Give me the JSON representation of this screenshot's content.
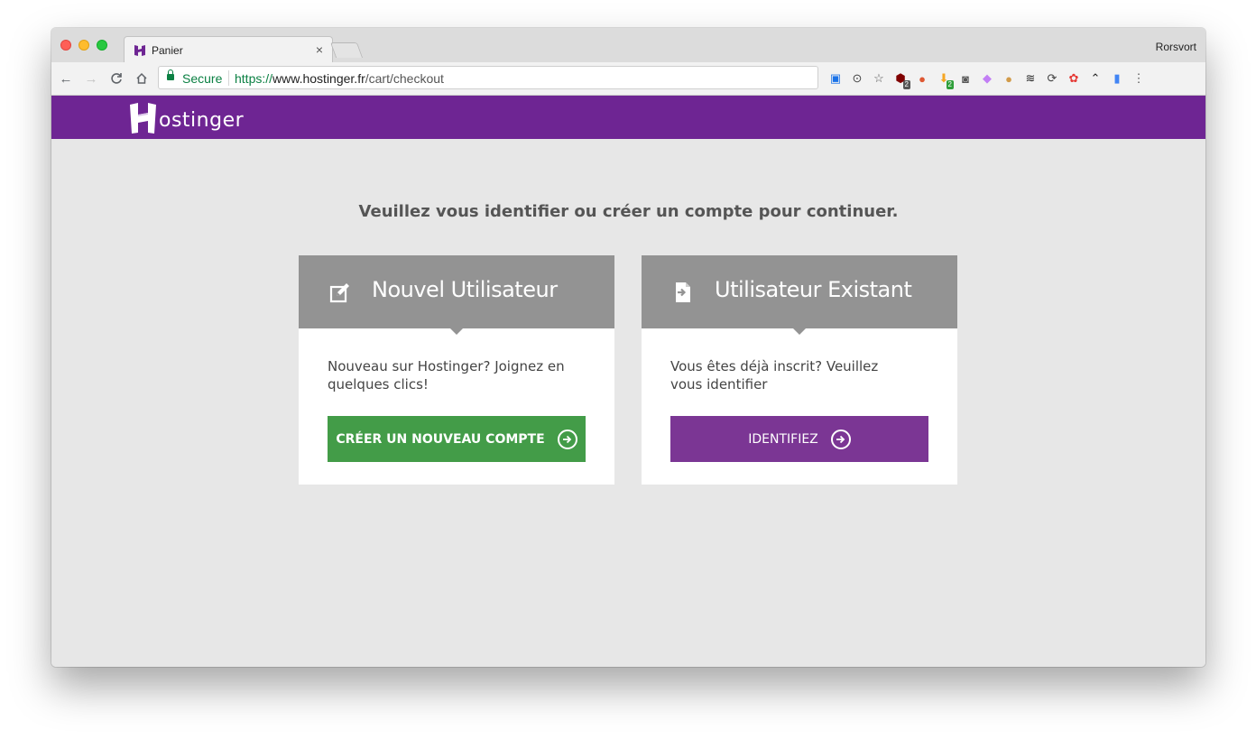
{
  "browser": {
    "tab_title": "Panier",
    "tab_close": "×",
    "profile_name": "Rorsvort",
    "secure_label": "Secure",
    "url_scheme": "https://",
    "url_host": "www.hostinger.fr",
    "url_path": "/cart/checkout",
    "nav": {
      "back": "←",
      "forward": "→",
      "reload": "C",
      "home": "⌂"
    },
    "extensions": [
      {
        "name": "trello-icon",
        "glyph": "▣",
        "color": "#1a73e8"
      },
      {
        "name": "password-icon",
        "glyph": "⊙",
        "color": "#444"
      },
      {
        "name": "star-icon",
        "glyph": "☆",
        "color": "#555"
      },
      {
        "name": "ublock-icon",
        "glyph": "⬢",
        "color": "#800000",
        "badge": "2",
        "badge_color": "#555"
      },
      {
        "name": "duckduckgo-icon",
        "glyph": "●",
        "color": "#de5833"
      },
      {
        "name": "download-icon",
        "glyph": "⬇",
        "color": "#f5a623",
        "badge": "2",
        "badge_color": "#2e9e3a"
      },
      {
        "name": "pocket-icon",
        "glyph": "◙",
        "color": "#555"
      },
      {
        "name": "feather-icon",
        "glyph": "◆",
        "color": "#c27ef5"
      },
      {
        "name": "cookie-icon",
        "glyph": "●",
        "color": "#d29b4a"
      },
      {
        "name": "buffer-icon",
        "glyph": "≋",
        "color": "#222"
      },
      {
        "name": "sync-icon",
        "glyph": "⟳",
        "color": "#444"
      },
      {
        "name": "colorpicker-icon",
        "glyph": "✿",
        "color": "#e53935"
      },
      {
        "name": "zigzag-icon",
        "glyph": "⌃",
        "color": "#222"
      },
      {
        "name": "sheets-icon",
        "glyph": "▮",
        "color": "#4285f4"
      },
      {
        "name": "menu-icon",
        "glyph": "⋮",
        "color": "#555"
      }
    ]
  },
  "site": {
    "logo_text": "ostinger",
    "brand_color": "#6e2593"
  },
  "page": {
    "intro": "Veuillez vous identifier ou créer un compte pour continuer.",
    "new_user": {
      "title": "Nouvel Utilisateur",
      "text": "Nouveau sur Hostinger? Joignez en quelques clics!",
      "button": "CRÉER UN NOUVEAU COMPTE",
      "button_color": "#439c48"
    },
    "existing_user": {
      "title": "Utilisateur Existant",
      "text": "Vous êtes déjà inscrit? Veuillez vous identifier",
      "button": "IDENTIFIEZ",
      "button_color": "#7b3694"
    }
  }
}
